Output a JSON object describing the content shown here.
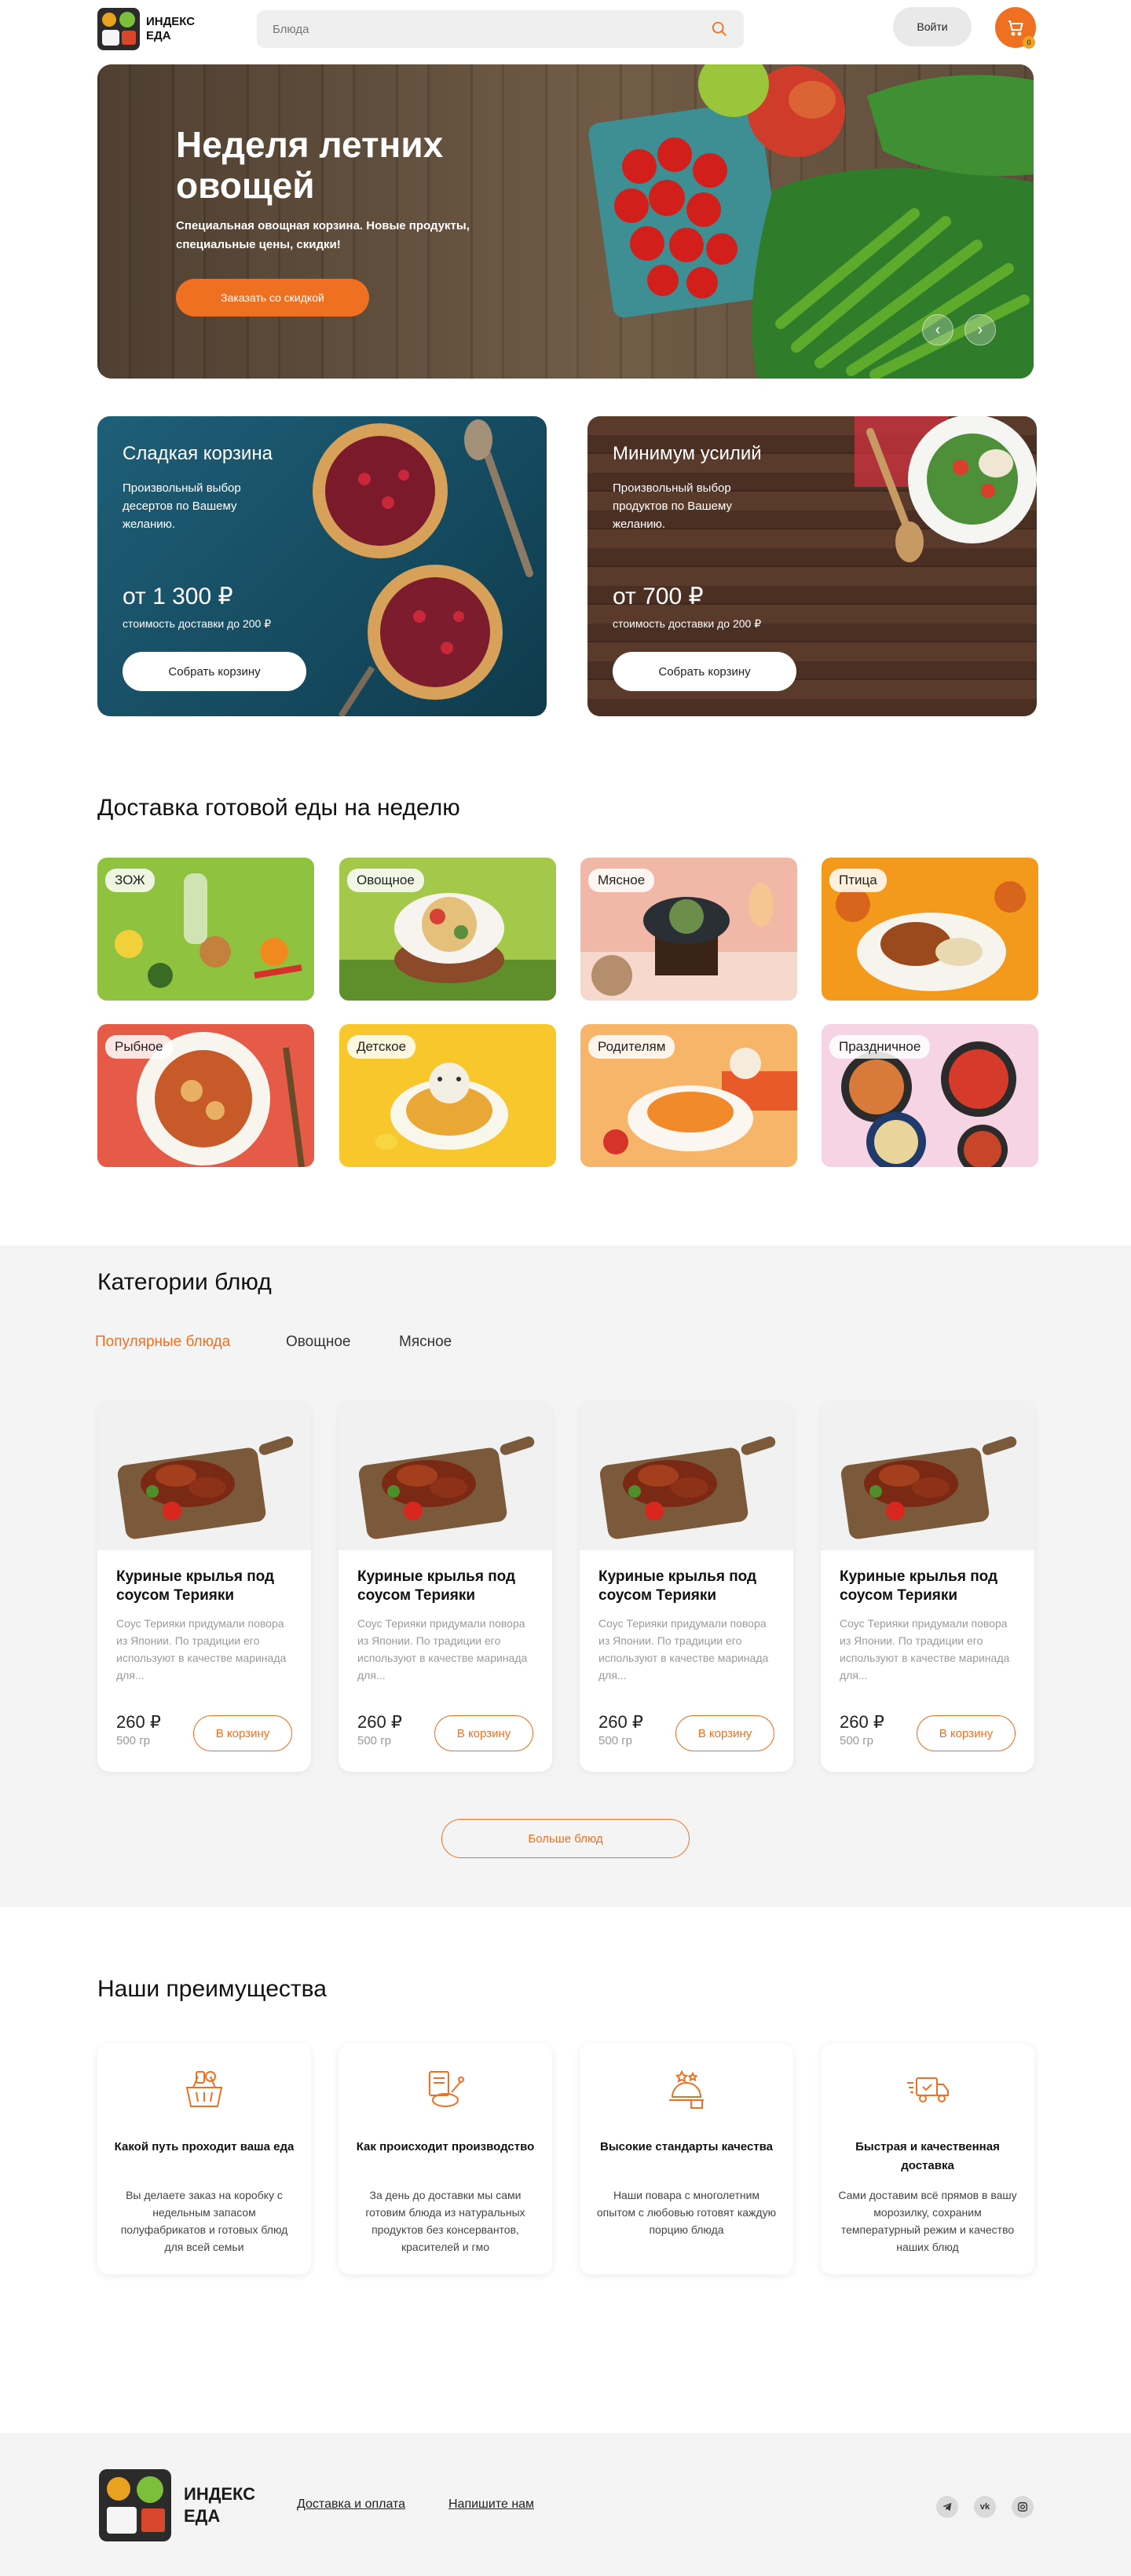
{
  "header": {
    "logo_text": "ИНДЕКС ЕДА",
    "search_placeholder": "Блюда",
    "login_label": "Войти",
    "cart_count": "0"
  },
  "hero": {
    "title": "Неделя летних овощей",
    "subtitle": "Специальная овощная корзина. Новые продукты, специальные цены, скидки!",
    "button_label": "Заказать со скидкой"
  },
  "promos": [
    {
      "title": "Сладкая корзина",
      "description": "Произвольный выбор десертов по Вашему желанию.",
      "price": "от 1 300 ₽",
      "note": "стоимость доставки до 200 ₽",
      "button_label": "Собрать корзину"
    },
    {
      "title": "Минимум усилий",
      "description": "Произвольный выбор продуктов по Вашему желанию.",
      "price": "от 700 ₽",
      "note": "стоимость доставки до 200 ₽",
      "button_label": "Собрать корзину"
    }
  ],
  "weekly": {
    "title": "Доставка готовой еды на неделю",
    "tiles": [
      {
        "label": "ЗОЖ",
        "color": "#8fc33f"
      },
      {
        "label": "Овощное",
        "color": "#a4c94a"
      },
      {
        "label": "Мясное",
        "color": "#f1b8a8"
      },
      {
        "label": "Птица",
        "color": "#f39a1d"
      },
      {
        "label": "Рыбное",
        "color": "#e65a48"
      },
      {
        "label": "Детское",
        "color": "#f7c72c"
      },
      {
        "label": "Родителям",
        "color": "#f7b56a"
      },
      {
        "label": "Праздничное",
        "color": "#f4bfd6"
      }
    ]
  },
  "categories": {
    "title": "Категории блюд",
    "tabs": [
      "Популярные блюда",
      "Овощное",
      "Мясное"
    ],
    "dishes": [
      {
        "name": "Куриные крылья под соусом Терияки",
        "description": "Соус Терияки придумали повора из Японии. По традиции его используют в качестве маринада для...",
        "price": "260 ₽",
        "weight": "500 гр",
        "button_label": "В корзину"
      },
      {
        "name": "Куриные крылья под соусом Терияки",
        "description": "Соус Терияки придумали повора из Японии. По традиции его используют в качестве маринада для...",
        "price": "260 ₽",
        "weight": "500 гр",
        "button_label": "В корзину"
      },
      {
        "name": "Куриные крылья под соусом Терияки",
        "description": "Соус Терияки придумали повора из Японии. По традиции его используют в качестве маринада для...",
        "price": "260 ₽",
        "weight": "500 гр",
        "button_label": "В корзину"
      },
      {
        "name": "Куриные крылья под соусом Терияки",
        "description": "Соус Терияки придумали повора из Японии. По традиции его используют в качестве маринада для...",
        "price": "260 ₽",
        "weight": "500 гр",
        "button_label": "В корзину"
      }
    ],
    "more_label": "Больше блюд"
  },
  "advantages": {
    "title": "Наши преимущества",
    "items": [
      {
        "icon": "food-basket-icon",
        "title": "Какой путь проходит ваша еда",
        "text": "Вы делаете заказ на коробку с недельным запасом полуфабрикатов и готовых блюд для всей семьи"
      },
      {
        "icon": "cooking-icon",
        "title": "Как происходит производство",
        "text": "За день до доставки мы сами готовим блюда из натуральных продуктов без консервантов, красителей и гмо"
      },
      {
        "icon": "chef-quality-icon",
        "title": "Высокие стандарты качества",
        "text": "Наши повара с многолетним опытом с любовью готовят каждую порцию блюда"
      },
      {
        "icon": "delivery-truck-icon",
        "title": "Быстрая и качественная доставка",
        "text": "Сами доставим всё прямов в вашу морозилку, сохраним температурный режим и качество наших блюд"
      }
    ]
  },
  "footer": {
    "logo_text": "ИНДЕКС ЕДА",
    "links": [
      "Доставка и оплата",
      "Напишите нам"
    ],
    "socials": [
      "telegram-icon",
      "vk-icon",
      "instagram-icon"
    ]
  },
  "colors": {
    "accent": "#f07022",
    "section_bg": "#f4f4f4"
  }
}
